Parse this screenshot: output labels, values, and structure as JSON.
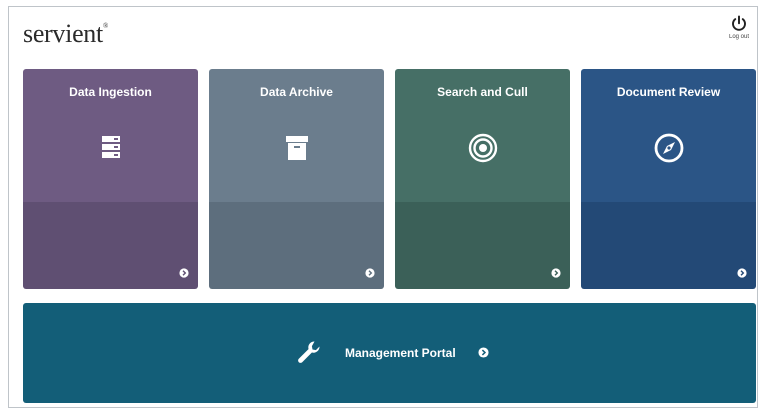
{
  "header": {
    "logo_prefix": "serv",
    "logo_i": "i",
    "logo_suffix": "ent",
    "logo_mark": "®",
    "logout_label": "Log out",
    "logout_icon": "power-icon"
  },
  "tiles": [
    {
      "label": "Data Ingestion",
      "icon": "server-icon",
      "color_top": "#6e5b82",
      "color_bottom": "#5f4f72"
    },
    {
      "label": "Data Archive",
      "icon": "archive-box-icon",
      "color_top": "#6b7d8d",
      "color_bottom": "#5d6e7d"
    },
    {
      "label": "Search and Cull",
      "icon": "target-icon",
      "color_top": "#466f66",
      "color_bottom": "#3b6058"
    },
    {
      "label": "Document Review",
      "icon": "compass-icon",
      "color_top": "#2b5586",
      "color_bottom": "#234976"
    }
  ],
  "portal": {
    "label": "Management Portal",
    "icon": "wrench-icon",
    "color": "#135e78"
  }
}
